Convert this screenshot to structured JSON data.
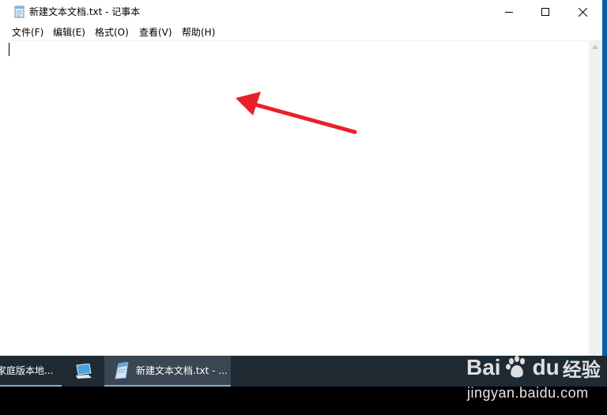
{
  "window": {
    "title": "新建文本文档.txt - 记事本",
    "menu": [
      "文件(F)",
      "编辑(E)",
      "格式(O)",
      "查看(V)",
      "帮助(H)"
    ]
  },
  "editor": {
    "content": ""
  },
  "taskbar": {
    "items": [
      {
        "label": "家庭版本地...",
        "icon": "app-icon"
      },
      {
        "label": "",
        "icon": "computer-icon"
      },
      {
        "label": "新建文本文档.txt - ...",
        "icon": "notepad-icon"
      }
    ]
  },
  "watermark": {
    "brand": "Bai",
    "brand2": "du",
    "cn": "经验",
    "url": "jingyan.baidu.com"
  },
  "colors": {
    "taskbar": "#1f2a33",
    "taskbar_active": "#3a4651",
    "accent": "#7fb0d8",
    "annotation_arrow": "#e8202a"
  }
}
